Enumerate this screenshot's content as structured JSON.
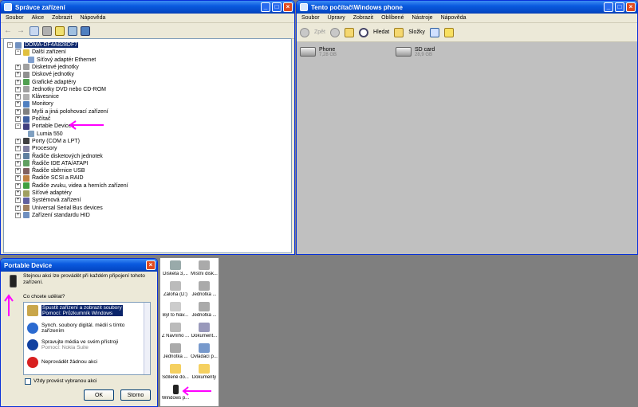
{
  "device_manager": {
    "title": "Správce zařízení",
    "menu": [
      "Soubor",
      "Akce",
      "Zobrazit",
      "Nápověda"
    ],
    "tree": [
      {
        "label": "DOMA-DF4A828DF7",
        "kind": "root"
      },
      {
        "label": "Další zařízení",
        "kind": "expanded"
      },
      {
        "label": "Síťový adaptér Ethernet",
        "kind": "child"
      },
      {
        "label": "Disketové jednotky",
        "kind": "collapsed"
      },
      {
        "label": "Diskové jednotky",
        "kind": "collapsed"
      },
      {
        "label": "Grafické adaptéry",
        "kind": "collapsed"
      },
      {
        "label": "Jednotky DVD nebo CD-ROM",
        "kind": "collapsed"
      },
      {
        "label": "Klávesnice",
        "kind": "collapsed"
      },
      {
        "label": "Monitory",
        "kind": "collapsed"
      },
      {
        "label": "Myši a jiná polohovací zařízení",
        "kind": "collapsed"
      },
      {
        "label": "Počítač",
        "kind": "collapsed"
      },
      {
        "label": "Portable Devices",
        "kind": "expanded"
      },
      {
        "label": "Lumia 550",
        "kind": "child"
      },
      {
        "label": "Porty (COM a LPT)",
        "kind": "collapsed"
      },
      {
        "label": "Procesory",
        "kind": "collapsed"
      },
      {
        "label": "Řadiče disketových jednotek",
        "kind": "collapsed"
      },
      {
        "label": "Řadiče IDE ATA/ATAPI",
        "kind": "collapsed"
      },
      {
        "label": "Řadiče sběrnice USB",
        "kind": "collapsed"
      },
      {
        "label": "Řadiče SCSI a RAID",
        "kind": "collapsed"
      },
      {
        "label": "Řadiče zvuku, videa a herních zařízení",
        "kind": "collapsed"
      },
      {
        "label": "Síťové adaptéry",
        "kind": "collapsed"
      },
      {
        "label": "Systémová zařízení",
        "kind": "collapsed"
      },
      {
        "label": "Universal Serial Bus devices",
        "kind": "collapsed"
      },
      {
        "label": "Zařízení standardu HID",
        "kind": "collapsed"
      }
    ]
  },
  "explorer": {
    "title": "Tento počítač\\Windows phone",
    "menu": [
      "Soubor",
      "Úpravy",
      "Zobrazit",
      "Oblíbené",
      "Nástroje",
      "Nápověda"
    ],
    "toolbar": {
      "back": "Zpět",
      "search": "Hledat",
      "folders": "Složky"
    },
    "drives": [
      {
        "name": "Phone",
        "size": "7,28 GB"
      },
      {
        "name": "SD card",
        "size": "28,9 GB"
      }
    ]
  },
  "portable_dialog": {
    "title": "Portable Device",
    "message": "Stejnou akci lze provádět při každém připojení tohoto zařízení.",
    "question": "Co chcete udělat?",
    "options": [
      {
        "line1": "Spustit zařízení a zobrazit soubory",
        "line2": "Pomocí: Průzkumník Windows"
      },
      {
        "line1": "Synch. soubory digitál. médií s tímto",
        "line2": "zařízením"
      },
      {
        "line1": "Spravujte média ve svém přístroji",
        "line2": "Pomocí: Nokia Suite"
      },
      {
        "line1": "Neprovádět žádnou akci",
        "line2": ""
      }
    ],
    "checkbox": "Vždy provést vybranou akci",
    "ok": "OK",
    "cancel": "Storno"
  },
  "mycomputer_panel": {
    "items": [
      "Disketa 3,...",
      "Místní disk...",
      "Záloha (D:)",
      "Jednotka ...",
      "Byl to hlav...",
      "Jednotka ...",
      "Z Navního ...",
      "Dokument...",
      "Jednotka ...",
      "Ovládací p...",
      "Sdílené do...",
      "Dokumenty",
      "Windows p..."
    ]
  },
  "colors": {
    "titlebar": "#0a5adf",
    "highlight": "#0a246a",
    "annotation": "#ff00ff"
  }
}
